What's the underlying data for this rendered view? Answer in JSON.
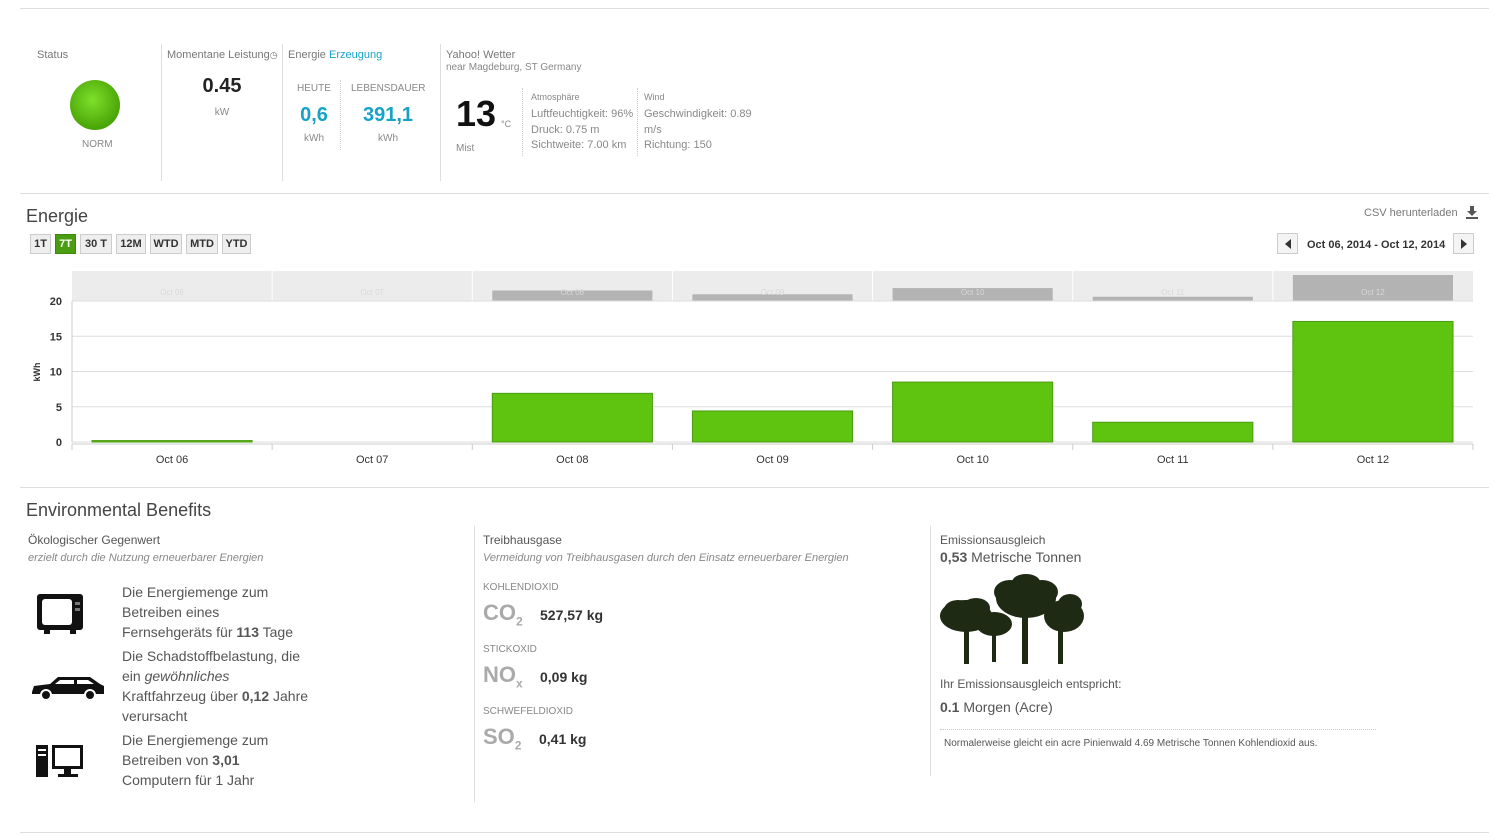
{
  "status": {
    "label": "Status",
    "state": "NORM",
    "color": "#5bbf0a"
  },
  "power": {
    "label": "Momentane Leistung",
    "value": "0.45",
    "unit": "kW"
  },
  "energy": {
    "label_prefix": "Energie",
    "label_link": "Erzeugung",
    "today_label": "HEUTE",
    "today_value": "0,6",
    "today_unit": "kWh",
    "lifetime_label": "LEBENSDAUER",
    "lifetime_value": "391,1",
    "lifetime_unit": "kWh"
  },
  "weather": {
    "title": "Yahoo! Wetter",
    "location": "near Magdeburg, ST Germany",
    "temp": "13",
    "temp_unit": "°C",
    "condition": "Mist",
    "atm_label": "Atmosphäre",
    "humidity": "Luftfeuchtigkeit: 96%",
    "pressure": "Druck: 0.75 m",
    "visibility": "Sichtweite: 7.00 km",
    "wind_label": "Wind",
    "wind_speed": "Geschwindigkeit: 0.89",
    "wind_unit": "m/s",
    "wind_dir": "Richtung: 150"
  },
  "energie_section": {
    "title": "Energie",
    "csv": "CSV herunterladen",
    "ranges": [
      "1T",
      "7T",
      "30 T",
      "12M",
      "WTD",
      "MTD",
      "YTD"
    ],
    "active_range": "7T",
    "date_range": "Oct 06, 2014 - Oct 12, 2014"
  },
  "chart_data": {
    "type": "bar",
    "categories": [
      "Oct 06",
      "Oct 07",
      "Oct 08",
      "Oct 09",
      "Oct 10",
      "Oct 11",
      "Oct 12"
    ],
    "values": [
      0.2,
      0,
      6.9,
      4.4,
      8.5,
      2.8,
      17.1
    ],
    "ylabel": "kWh",
    "ylim": [
      0,
      20
    ],
    "yticks": [
      0,
      5,
      10,
      15,
      20
    ],
    "grid": true,
    "bar_color": "#5ec410",
    "navigator_values": [
      0.2,
      0,
      6.9,
      4.4,
      8.5,
      2.8,
      17.1
    ]
  },
  "env": {
    "title": "Environmental Benefits",
    "eco_title": "Ökologischer Gegenwert",
    "eco_sub": "erzielt durch die Nutzung erneuerbarer Energien",
    "tv": {
      "a": "Die Energiemenge zum",
      "b": "Betreiben eines",
      "c": "Fernsehgeräts für ",
      "num": "113",
      "d": " Tage"
    },
    "car": {
      "a": "Die Schadstoffbelastung, die",
      "b1": "ein ",
      "b2": "gewöhnliches",
      "c": "Kraftfahrzeug über ",
      "num": "0,12",
      "d": " Jahre",
      "e": "verursacht"
    },
    "pc": {
      "a": "Die Energiemenge zum",
      "b": "Betreiben von ",
      "num": "3,01",
      "c": "Computern für 1 Jahr"
    },
    "ghg_title": "Treibhausgase",
    "ghg_sub": "Vermeidung von Treibhausgasen durch den Einsatz erneuerbarer Energien",
    "co2_label": "KOHLENDIOXID",
    "co2_sym": "CO",
    "co2_sub": "2",
    "co2_val": "527,57 kg",
    "nox_label": "STICKOXID",
    "nox_sym": "NO",
    "nox_sub": "x",
    "nox_val": "0,09 kg",
    "so2_label": "SCHWEFELDIOXID",
    "so2_sym": "SO",
    "so2_sub": "2",
    "so2_val": "0,41 kg",
    "offset_title": "Emissionsausgleich",
    "offset_num": "0,53",
    "offset_unit": " Metrische Tonnen",
    "offset_equiv": "Ihr Emissionsausgleich entspricht:",
    "acre_num": "0.1",
    "acre_unit": " Morgen (Acre)",
    "note": "Normalerweise gleicht ein acre Pinienwald 4.69 Metrische Tonnen Kohlendioxid aus."
  }
}
